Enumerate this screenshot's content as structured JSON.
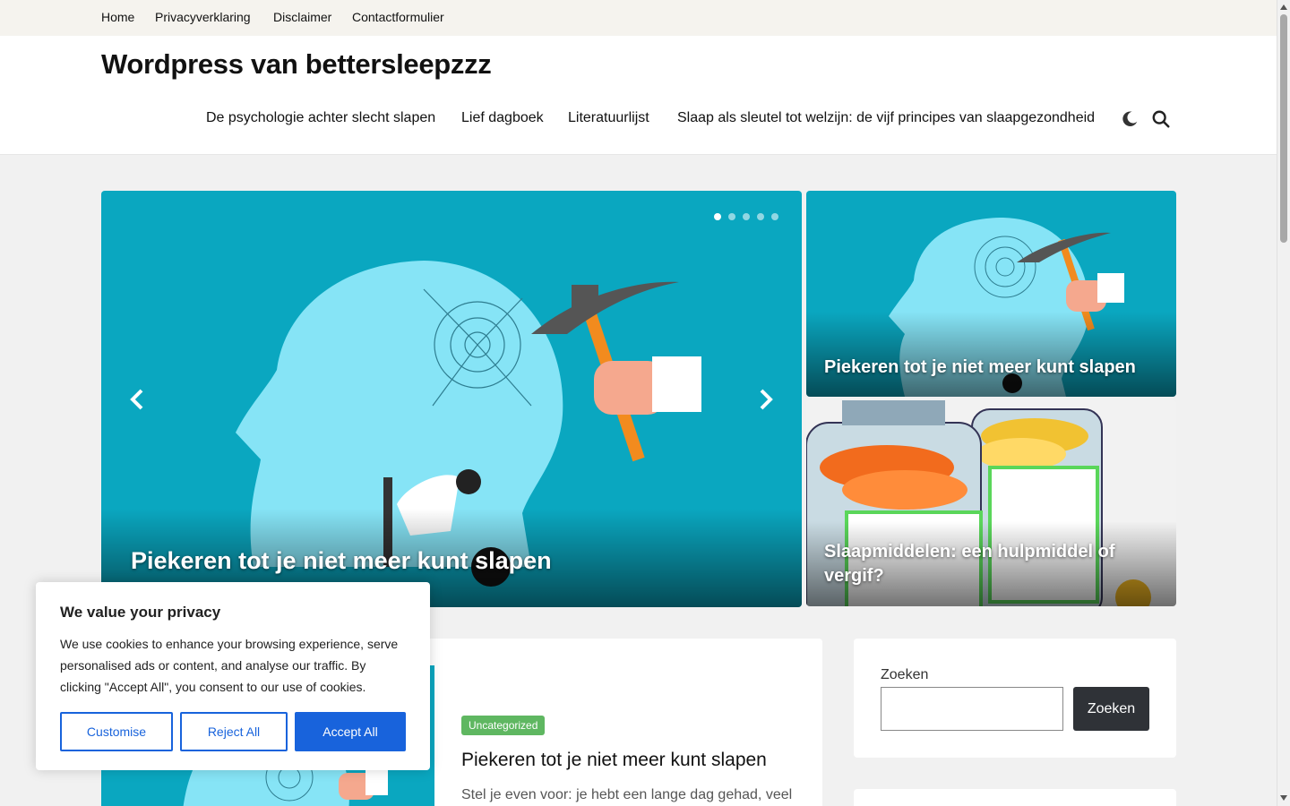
{
  "topnav": [
    "Home",
    "Privacyverklaring",
    "Disclaimer",
    "Contactformulier"
  ],
  "site_title": "Wordpress van bettersleepzzz",
  "mainnav": [
    "De psychologie achter slecht slapen",
    "Lief dagboek",
    "Literatuurlijst",
    "Slaap als sleutel tot welzijn: de vijf principes van slaapgezondheid"
  ],
  "icons": {
    "dark_mode": "moon-icon",
    "search": "search-icon",
    "prev": "chevron-left-icon",
    "next": "chevron-right-icon"
  },
  "slider": {
    "caption": "Piekeren tot je niet meer kunt slapen",
    "slide_count": 5,
    "active_slide": 1
  },
  "cards": [
    {
      "caption": "Piekeren tot je niet meer kunt slapen"
    },
    {
      "caption": "Slaapmiddelen: een hulpmiddel of vergif?"
    }
  ],
  "post": {
    "category": "Uncategorized",
    "title": "Piekeren tot je niet meer kunt slapen",
    "excerpt": "Stel je even voor: je hebt een lange dag gehad, veel"
  },
  "search_widget": {
    "label": "Zoeken",
    "value": "",
    "button": "Zoeken"
  },
  "cookie": {
    "title": "We value your privacy",
    "text": "We use cookies to enhance your browsing experience, serve personalised ads or content, and analyse our traffic. By clicking \"Accept All\", you consent to our use of cookies.",
    "customise": "Customise",
    "reject": "Reject All",
    "accept": "Accept All"
  },
  "colors": {
    "slide_bg": "#0aa7c0",
    "badge": "#5fb761",
    "cookie_accent": "#1863dc",
    "search_button": "#2f3237"
  }
}
